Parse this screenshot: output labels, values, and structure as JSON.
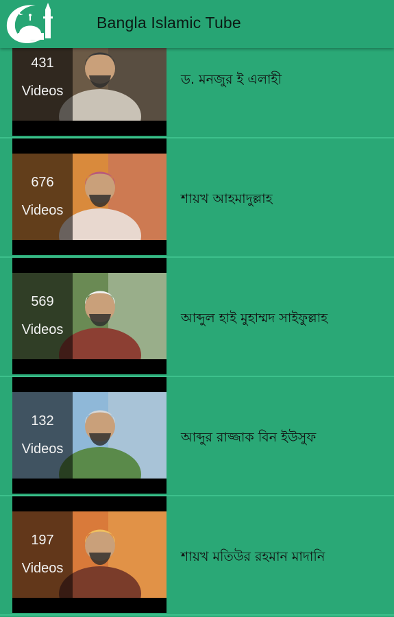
{
  "app": {
    "title": "Bangla Islamic Tube",
    "colors": {
      "appbar": "#27a574",
      "background": "#2aa876",
      "divider": "#3dc08c",
      "text": "#111111"
    }
  },
  "playlists": [
    {
      "count": "431",
      "count_label": "Videos",
      "name": "ড. মনজুর ই এলাহী",
      "thumb_palette": [
        "#6b5a46",
        "#c9c2b6",
        "#3a3a3a"
      ]
    },
    {
      "count": "676",
      "count_label": "Videos",
      "name": "শায়খ আহমাদুল্লাহ",
      "thumb_palette": [
        "#d98a3c",
        "#e8d8cf",
        "#b85b7a"
      ]
    },
    {
      "count": "569",
      "count_label": "Videos",
      "name": "আব্দুল হাই মুহাম্মদ সাইফুল্লাহ",
      "thumb_palette": [
        "#6a8a54",
        "#8c3f33",
        "#f2f2f2"
      ]
    },
    {
      "count": "132",
      "count_label": "Videos",
      "name": "আব্দুর রাজ্জাক বিন ইউসুফ",
      "thumb_palette": [
        "#8fb8d8",
        "#5a8a4a",
        "#d8d8d8"
      ]
    },
    {
      "count": "197",
      "count_label": "Videos",
      "name": "শায়খ মতিউর রহমান মাদানি",
      "thumb_palette": [
        "#d97a3a",
        "#7a3c2a",
        "#f0c060"
      ]
    }
  ]
}
